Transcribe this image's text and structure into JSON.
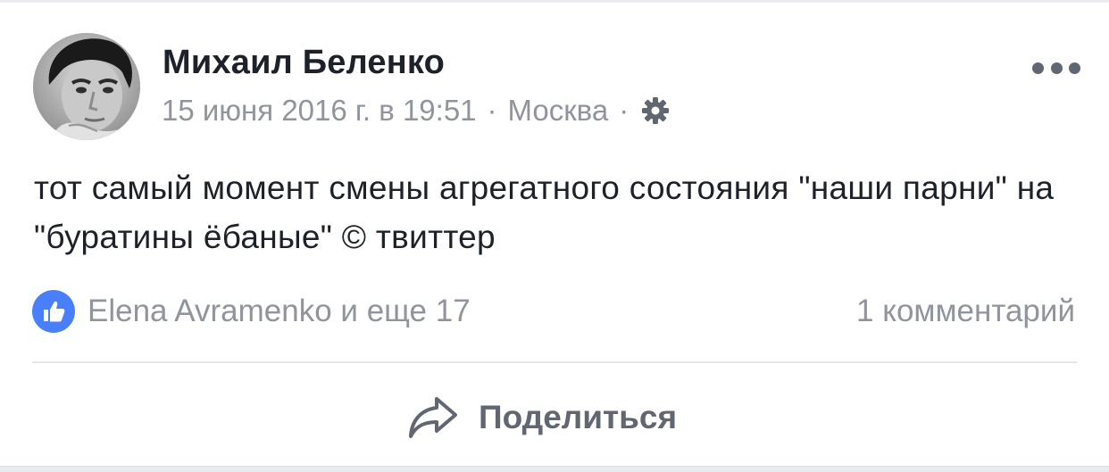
{
  "post": {
    "author": "Михаил Беленко",
    "date": "15 июня 2016 г. в 19:51",
    "separator": "·",
    "location": "Москва",
    "privacy_icon": "gear-icon",
    "more_icon": "more-dots-icon",
    "text": "тот самый момент смены агрегатного состояния \"наши парни\" на \"буратины ёбаные\" © твиттер",
    "reactions": {
      "icon": "like-icon",
      "label": "Elena Avramenko и еще 17"
    },
    "comments_label": "1 комментарий",
    "share": {
      "icon": "share-arrow-icon",
      "label": "Поделиться"
    }
  },
  "colors": {
    "like_blue": "#4a7ffc",
    "text_primary": "#1d2129",
    "text_secondary": "#90949c",
    "divider": "#e4e6eb"
  }
}
